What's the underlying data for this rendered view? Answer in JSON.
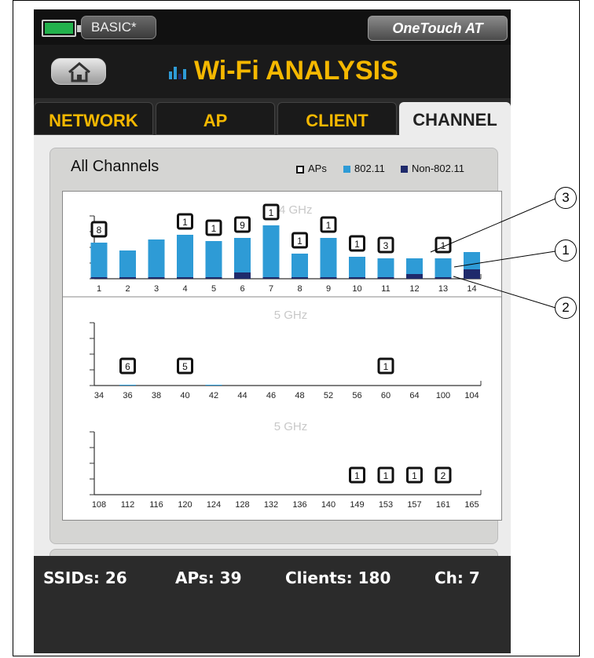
{
  "status_bar": {
    "mode_label": "BASIC*",
    "product_label": "OneTouch AT"
  },
  "header": {
    "title": "Wi-Fi ANALYSIS"
  },
  "tabs": [
    {
      "label": "NETWORK",
      "active": false
    },
    {
      "label": "AP",
      "active": false
    },
    {
      "label": "CLIENT",
      "active": false
    },
    {
      "label": "CHANNEL",
      "active": true
    }
  ],
  "panel": {
    "title": "All Channels",
    "legend": [
      {
        "label": "APs",
        "color": "#111111"
      },
      {
        "label": "802.11",
        "color": "#2e9bd6"
      },
      {
        "label": "Non-802.11",
        "color": "#1f2a6b"
      }
    ]
  },
  "chart_data": [
    {
      "type": "bar",
      "title": "2.4 GHz",
      "categories": [
        "1",
        "2",
        "3",
        "4",
        "5",
        "6",
        "7",
        "8",
        "9",
        "10",
        "11",
        "12",
        "13",
        "14"
      ],
      "series": [
        {
          "name": "802.11",
          "values": [
            4.6,
            3.6,
            5.0,
            5.6,
            4.8,
            5.2,
            6.8,
            3.2,
            5.2,
            2.8,
            2.6,
            2.6,
            2.6,
            3.4
          ]
        },
        {
          "name": "Non-802.11",
          "values": [
            0.2,
            0.2,
            0.2,
            0.2,
            0.2,
            0.8,
            0.2,
            0.2,
            0.2,
            0.2,
            0.2,
            0.6,
            0.2,
            1.2
          ]
        }
      ],
      "ap_counts": [
        "8",
        "",
        "",
        "1",
        "1",
        "9",
        "1",
        "1",
        "1",
        "1",
        "3",
        "",
        "1",
        ""
      ],
      "ylim": [
        0,
        10
      ]
    },
    {
      "type": "bar",
      "title": "5 GHz",
      "categories": [
        "34",
        "36",
        "38",
        "40",
        "42",
        "44",
        "46",
        "48",
        "52",
        "56",
        "60",
        "64",
        "100",
        "104"
      ],
      "series": [
        {
          "name": "802.11",
          "values": [
            0,
            0.1,
            0,
            0,
            0.1,
            0,
            0,
            0,
            0,
            0,
            0,
            0,
            0,
            0
          ]
        },
        {
          "name": "Non-802.11",
          "values": [
            0,
            0,
            0,
            0,
            0,
            0,
            0,
            0,
            0,
            0,
            0,
            0,
            0,
            0
          ]
        }
      ],
      "ap_counts": [
        "",
        "6",
        "",
        "5",
        "",
        "",
        "",
        "",
        "",
        "",
        "1",
        "",
        "",
        ""
      ],
      "ylim": [
        0,
        10
      ]
    },
    {
      "type": "bar",
      "title": "5 GHz",
      "categories": [
        "108",
        "112",
        "116",
        "120",
        "124",
        "128",
        "132",
        "136",
        "140",
        "149",
        "153",
        "157",
        "161",
        "165"
      ],
      "series": [
        {
          "name": "802.11",
          "values": [
            0,
            0,
            0,
            0,
            0,
            0,
            0,
            0,
            0,
            0,
            0,
            0,
            0,
            0
          ]
        },
        {
          "name": "Non-802.11",
          "values": [
            0,
            0,
            0,
            0,
            0,
            0,
            0,
            0,
            0,
            0,
            0,
            0,
            0,
            0
          ]
        }
      ],
      "ap_counts": [
        "",
        "",
        "",
        "",
        "",
        "",
        "",
        "",
        "",
        "1",
        "1",
        "1",
        "2",
        ""
      ],
      "ylim": [
        0,
        10
      ]
    }
  ],
  "footer": {
    "ssids": "SSIDs: 26",
    "aps": "APs: 39",
    "clients": "Clients: 180",
    "channel": "Ch: 7"
  },
  "callouts": [
    "3",
    "1",
    "2"
  ],
  "colors": {
    "accent": "#f5b800",
    "bar": "#2e9bd6",
    "non80211": "#1f2a6b"
  }
}
